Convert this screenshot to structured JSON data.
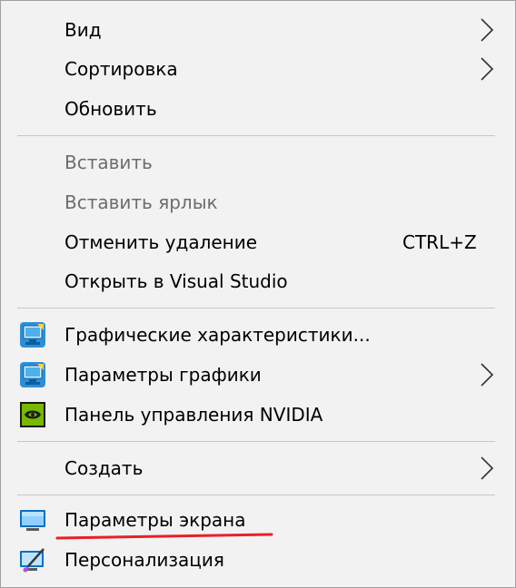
{
  "menu": {
    "items": [
      {
        "label": "Вид"
      },
      {
        "label": "Сортировка"
      },
      {
        "label": "Обновить"
      },
      {
        "label": "Вставить"
      },
      {
        "label": "Вставить ярлык"
      },
      {
        "label": "Отменить удаление",
        "shortcut": "CTRL+Z"
      },
      {
        "label": "Открыть в Visual Studio"
      },
      {
        "label": "Графические характеристики...",
        "icon": "intel-graphics-icon"
      },
      {
        "label": "Параметры графики",
        "icon": "intel-graphics-icon"
      },
      {
        "label": "Панель управления NVIDIA",
        "icon": "nvidia-icon"
      },
      {
        "label": "Создать"
      },
      {
        "label": "Параметры экрана",
        "icon": "display-icon"
      },
      {
        "label": "Персонализация",
        "icon": "personalization-icon"
      }
    ]
  },
  "colors": {
    "menu_background": "#f2f2f2",
    "disabled_text": "#6d6d6d",
    "highlight_underline": "#e8202a"
  }
}
